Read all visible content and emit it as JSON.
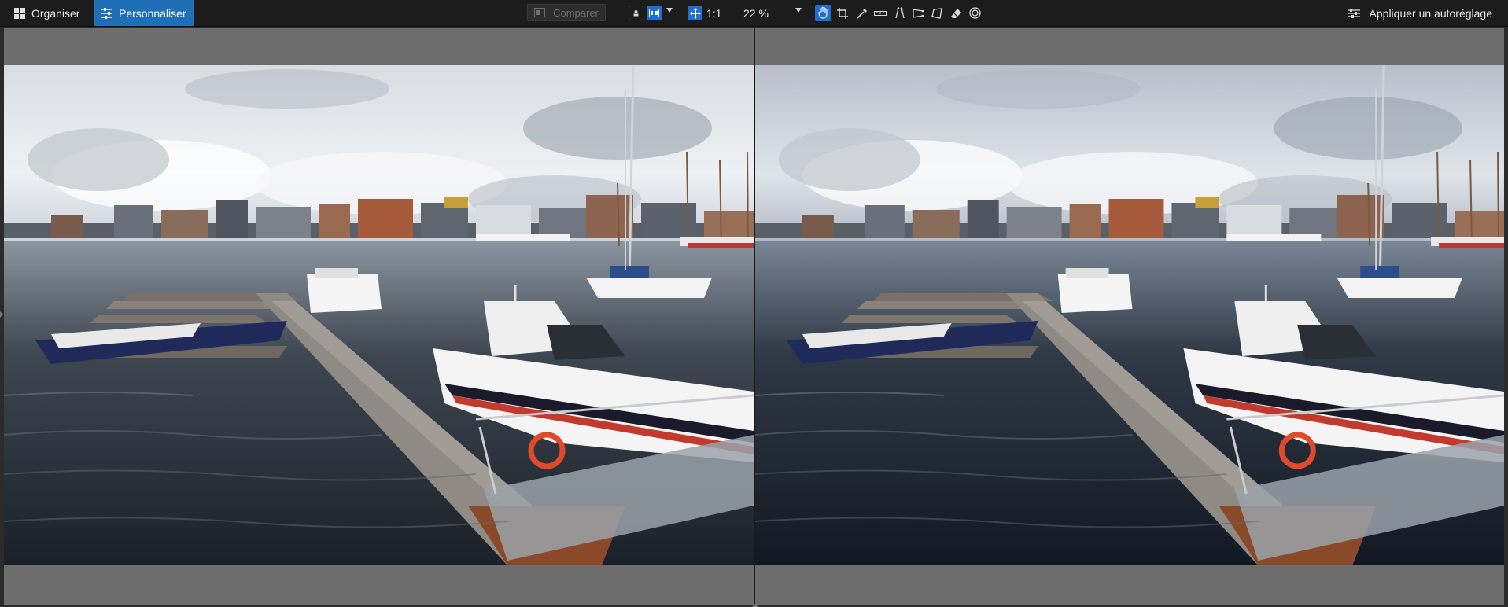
{
  "toolbar": {
    "tabs": [
      {
        "label": "Organiser",
        "icon": "grid-icon",
        "active": false
      },
      {
        "label": "Personnaliser",
        "icon": "sliders-icon",
        "active": true
      }
    ],
    "compare_label": "Comparer",
    "one_to_one_label": "1:1",
    "zoom_value": "22 %",
    "tools": [
      "hand-icon",
      "crop-icon",
      "eyedropper-icon",
      "straighten-icon",
      "perspective-vertical-icon",
      "perspective-horizontal-icon",
      "perspective-rectangle-icon",
      "eraser-icon",
      "spot-removal-icon"
    ],
    "auto_adjust_label": "Appliquer un autoréglage"
  },
  "viewer": {
    "mode": "side-by-side",
    "before_image": "harbor-photo-original",
    "after_image": "harbor-photo-corrected"
  },
  "colors": {
    "accent": "#1e6fb6",
    "toolbar_bg": "#1c1c1c",
    "viewer_bg": "#6d6d6d"
  }
}
